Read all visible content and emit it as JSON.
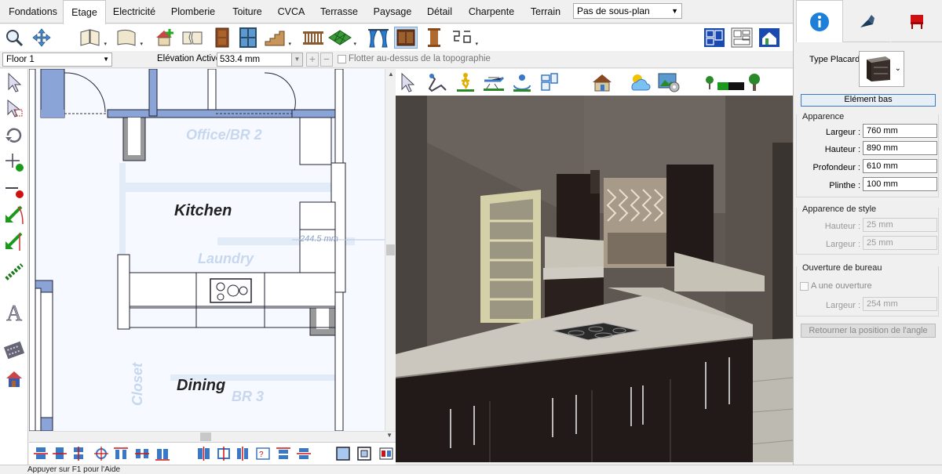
{
  "menu_tabs": [
    "Fondations",
    "Etage",
    "Electricité",
    "Plomberie",
    "Toiture",
    "CVCA",
    "Terrasse",
    "Paysage",
    "Détail",
    "Charpente",
    "Terrain"
  ],
  "active_tab": "Etage",
  "plan_select": "Pas de sous-plan",
  "floor_select": "Floor 1",
  "elevation_label": "Elévation Active:",
  "elevation_value": "533.4 mm",
  "float_label": "Flotter au-dessus de la topographie",
  "plan": {
    "kitchen": "Kitchen",
    "dining": "Dining",
    "office": "Office/BR 2",
    "laundry": "Laundry",
    "closet": "Closet",
    "br3": "BR 3",
    "dimension": "244.5 mm"
  },
  "status": "Appuyer sur F1 pour l'Aide",
  "panel": {
    "type_label": "Type Placard:",
    "element_button": "Elément bas",
    "apparence": {
      "title": "Apparence",
      "rows": [
        {
          "label": "Largeur :",
          "value": "760 mm"
        },
        {
          "label": "Hauteur :",
          "value": "890 mm"
        },
        {
          "label": "Profondeur :",
          "value": "610 mm"
        },
        {
          "label": "Plinthe :",
          "value": "100 mm"
        }
      ]
    },
    "style": {
      "title": "Apparence de style",
      "rows": [
        {
          "label": "Hauteur :",
          "value": "25 mm"
        },
        {
          "label": "Largeur :",
          "value": "25 mm"
        }
      ]
    },
    "ouverture": {
      "title": "Ouverture de bureau",
      "checkbox_label": "A une ouverture",
      "row": {
        "label": "Largeur :",
        "value": "254 mm"
      }
    },
    "return_button": "Retourner la position de l'angle"
  },
  "colors": {
    "accent": "#3a78c8",
    "info_icon": "#1e7fd8",
    "pen_icon": "#1a3a5c",
    "chair_icon": "#d01010"
  },
  "icons": {
    "toolbar": [
      "zoom-icon",
      "pan-icon",
      "open-book-icon",
      "page-curl-icon",
      "house-add-icon",
      "torn-paper-icon",
      "door-icon",
      "window-icon",
      "stairs-icon",
      "railing-icon",
      "terrain-grid-icon",
      "curtain-icon",
      "cabinet-icon",
      "column-icon",
      "pattern-icon"
    ],
    "toolbar_right": [
      "floor-plan-view-icon",
      "layout-view-icon",
      "elevation-view-icon"
    ],
    "left": [
      "select-arrow-icon",
      "select-group-icon",
      "rotate-icon",
      "add-point-icon",
      "line-red-dot-icon",
      "arrow-diagonal-icon",
      "arrow-diagonal-2-icon",
      "chain-icon",
      "text-icon",
      "film-icon",
      "house-small-icon"
    ],
    "view3d": [
      "camera-arrow-icon",
      "eyedropper-icon",
      "walk-icon",
      "aerial-icon",
      "orbit-icon",
      "plan-outline-icon",
      "house-view-icon",
      "sun-cloud-icon",
      "image-settings-icon",
      "tree-slider-icon"
    ],
    "bottom": [
      "align-top-icon",
      "align-middle-icon",
      "align-bottom-icon",
      "center-cross-icon",
      "distribute-icon",
      "align-line-icon",
      "space-icon",
      "align-left-icon",
      "align-center-icon",
      "align-right-icon",
      "equal-space-icon",
      "top-edge-icon",
      "middle-edge-icon",
      "frame-icon",
      "nested-frame-icon",
      "split-icon"
    ]
  }
}
